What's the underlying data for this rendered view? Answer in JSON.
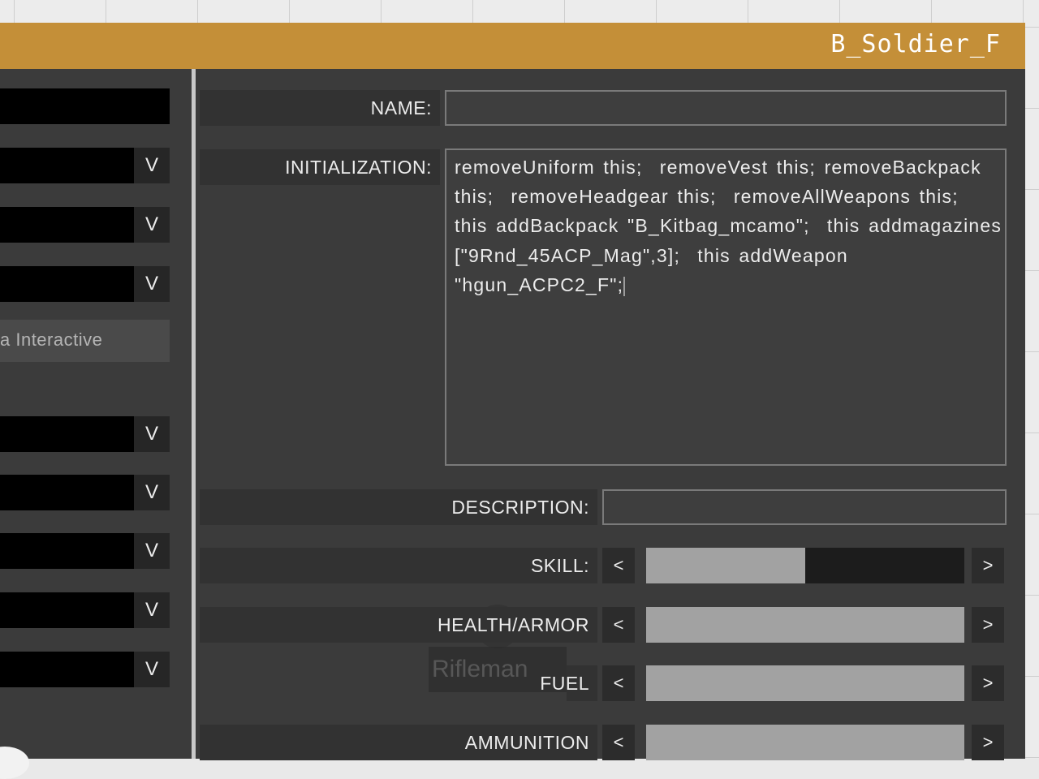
{
  "window": {
    "title": "B_Soldier_F"
  },
  "left_panel": {
    "dropdown_glyph": "V",
    "interactive_text": "a Interactive"
  },
  "form": {
    "name_label": "NAME:",
    "name_value": "",
    "init_label": "INITIALIZATION:",
    "init_value": "removeUniform this;  removeVest this; removeBackpack this;  removeHeadgear this;  removeAllWeapons this;  this addBackpack \"B_Kitbag_mcamo\";  this addmagazines [\"9Rnd_45ACP_Mag\",3];  this addWeapon \"hgun_ACPC2_F\";",
    "description_label": "DESCRIPTION:",
    "description_value": "",
    "sliders": [
      {
        "label": "SKILL:",
        "fill": 0.5
      },
      {
        "label": "HEALTH/ARMOR",
        "fill": 1.0
      },
      {
        "label": "FUEL",
        "fill": 1.0
      },
      {
        "label": "AMMUNITION",
        "fill": 1.0
      }
    ],
    "arrow_left": "<",
    "arrow_right": ">"
  },
  "map_overlay": {
    "unit_label": "Rifleman"
  },
  "colors": {
    "title_bar": "#c48f38",
    "panel": "#3b3b3b",
    "slider_fill": "#a2a2a2"
  }
}
